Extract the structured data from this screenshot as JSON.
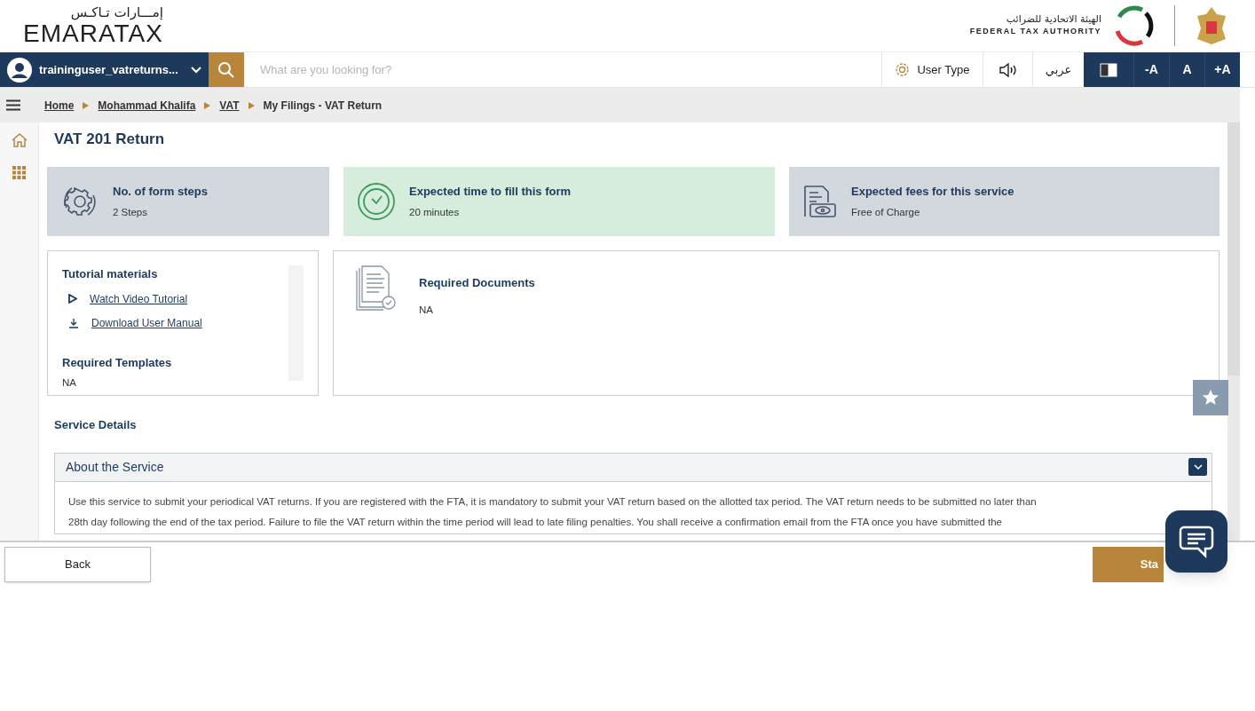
{
  "header": {
    "logo_arabic": "إمـــارات تـاكـس",
    "logo_text": "EMARATAX",
    "authority_arabic": "الهيئة الاتحادية للضرائب",
    "authority_english": "FEDERAL TAX AUTHORITY"
  },
  "nav": {
    "user": "traininguser_vatreturns...",
    "search": {
      "placeholder": "What are you looking for?"
    },
    "user_type": "User Type",
    "language": "عربي",
    "font_buttons": [
      "-A",
      "A",
      "+A"
    ]
  },
  "breadcrumb": [
    {
      "label": "Home",
      "link": true
    },
    {
      "label": "Mohammad Khalifa",
      "link": true
    },
    {
      "label": "VAT",
      "link": true
    },
    {
      "label": "My Filings - VAT Return",
      "link": false
    }
  ],
  "page_title": "VAT 201 Return",
  "info_cards": [
    {
      "kind": "steps",
      "title": "No. of form steps",
      "value": "2 Steps",
      "color": "#d3d8df"
    },
    {
      "kind": "time",
      "title": "Expected time to fill this form",
      "value": "20 minutes",
      "color": "#d6ecdd"
    },
    {
      "kind": "fees",
      "title": "Expected fees for this service",
      "value": "Free of Charge",
      "color": "#d3d8df"
    }
  ],
  "tutorial": {
    "title": "Tutorial materials",
    "links": [
      {
        "kind": "video",
        "label": "Watch Video Tutorial"
      },
      {
        "kind": "download",
        "label": "Download User Manual"
      }
    ],
    "templates_title": "Required Templates",
    "templates_value": "NA"
  },
  "documents": {
    "title": "Required Documents",
    "value": "NA"
  },
  "service_details": {
    "title": "Service Details",
    "accordion": {
      "title": "About the Service",
      "expanded": true,
      "lines": [
        "Use this service to submit your periodical VAT returns. If you are registered with the FTA, it is mandatory to submit your VAT return based on the allotted tax period. The VAT return needs to be submitted no later than",
        "28th day following the end of the tax period. Failure to file the VAT return within the time period will lead to late filing penalties. You shall receive a confirmation email from the FTA once you have submitted the"
      ]
    }
  },
  "footer": {
    "back": "Back",
    "start": "Sta"
  }
}
